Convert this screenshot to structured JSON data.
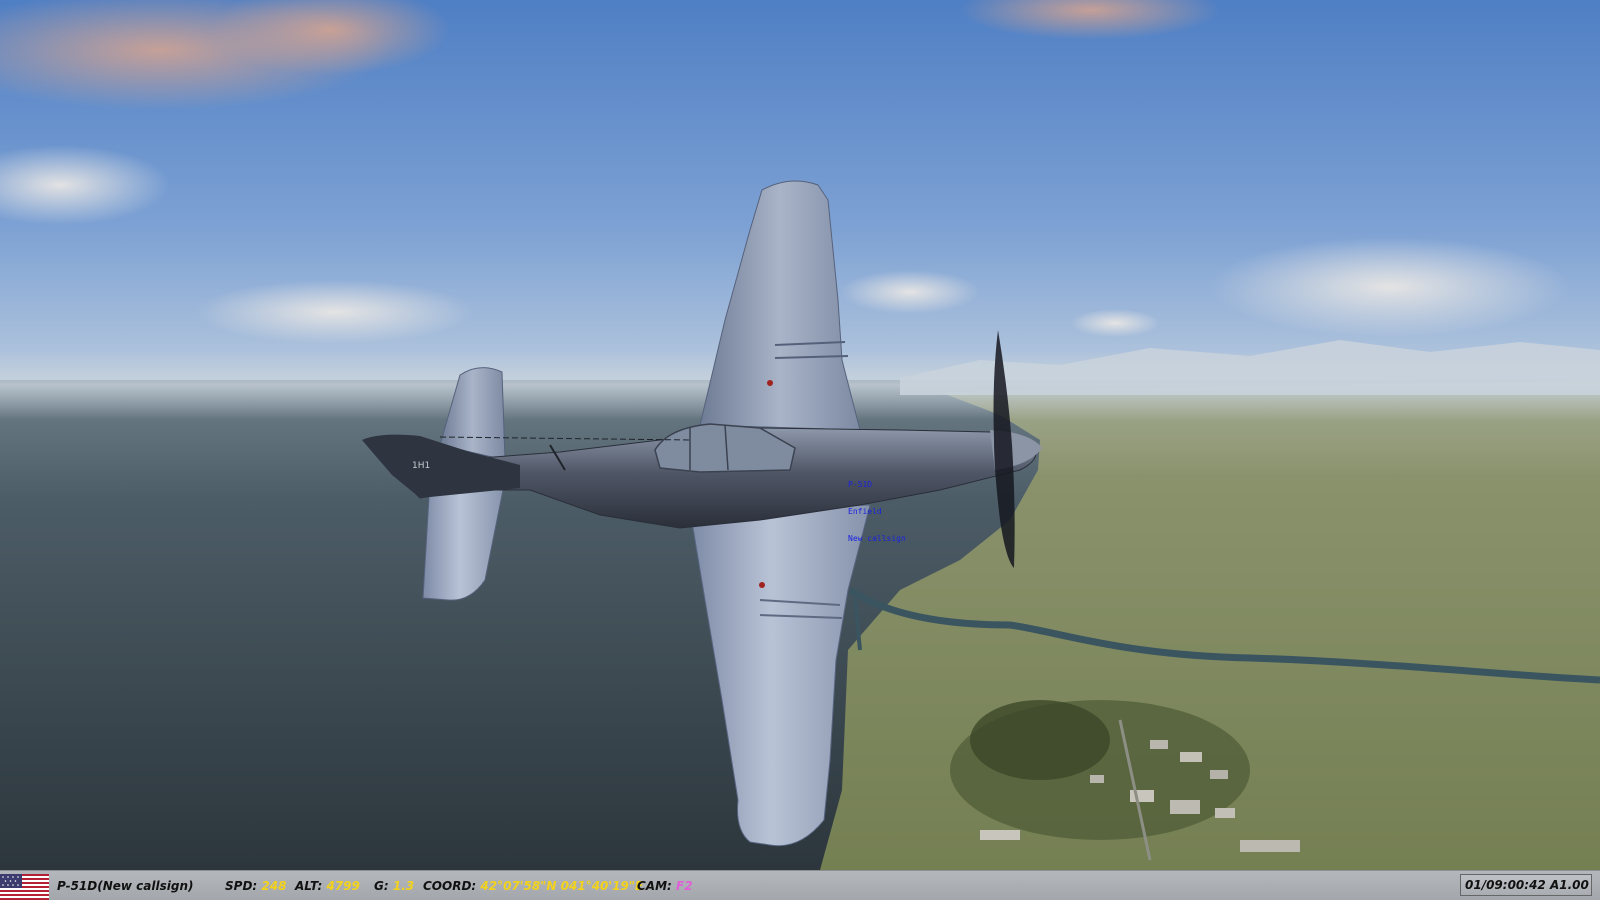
{
  "scene": {
    "aircraft_marking": "1H1",
    "unit_label": [
      "P-51D",
      "Enfield",
      "New callsign"
    ]
  },
  "hud": {
    "flag_icon": "us-flag-icon",
    "unit": "P-51D(New callsign)",
    "spd_label": "SPD:",
    "spd_value": "248",
    "alt_label": "ALT:",
    "alt_value": "4799",
    "g_label": "G:",
    "g_value": "1.3",
    "coord_label": "COORD:",
    "coord_value": "42°07'58\"N 041°40'19\"E",
    "cam_label": "CAM:",
    "cam_value": "F2",
    "clock": "01/09:00:42 A1.00"
  },
  "colors": {
    "hud_value": "#f2d21b",
    "hud_camera": "#e060d8",
    "unit_label": "#1a22e0"
  }
}
